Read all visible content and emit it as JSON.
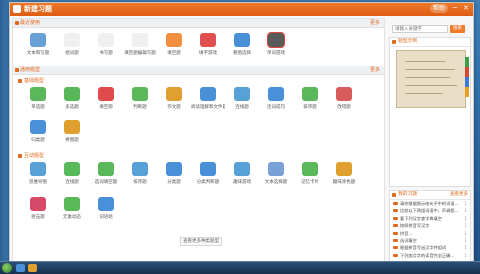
{
  "window": {
    "title": "新建习题",
    "help_label": "帮助",
    "min": "─",
    "close": "✕"
  },
  "recent_section": {
    "title": "最近使用",
    "more": "更多"
  },
  "recent_tiles": [
    {
      "label": "文本和写题",
      "icon": "vol-icon",
      "color": "#6aa0d8"
    },
    {
      "label": "组词题",
      "icon": "word-icon",
      "color": "#f0f0f0"
    },
    {
      "label": "书写题",
      "icon": "write-icon",
      "color": "#f0f0f0"
    },
    {
      "label": "填空题编辑写题",
      "icon": "edit-icon",
      "color": "#f0f0f0"
    },
    {
      "label": "填空题",
      "icon": "blocks-icon",
      "color": "#f09040"
    },
    {
      "label": "填字游戏",
      "icon": "grid-icon",
      "color": "#e05050"
    },
    {
      "label": "看图选择",
      "icon": "abc-icon",
      "color": "#4a90d8"
    },
    {
      "label": "单词游戏",
      "icon": "game-icon",
      "color": "#5a5a5a"
    }
  ],
  "common_section": {
    "title": "通用题型",
    "more": "更多"
  },
  "basic_label": "基础题型",
  "basic_row1": [
    {
      "label": "单选题",
      "icon": "single-choice-icon",
      "color": "#58b85a"
    },
    {
      "label": "多选题",
      "icon": "multi-choice-icon",
      "color": "#58b85a"
    },
    {
      "label": "填空题",
      "icon": "question-icon",
      "color": "#e04a4a"
    },
    {
      "label": "判断题",
      "icon": "judge-icon",
      "color": "#58b85a"
    },
    {
      "label": "作文题",
      "icon": "pen-icon",
      "color": "#e0a030"
    },
    {
      "label": "阅读理解和文件题",
      "icon": "check-grid-icon",
      "color": "#4a90d8"
    },
    {
      "label": "连线题",
      "icon": "link-icon",
      "color": "#58a0d8"
    },
    {
      "label": "连词成句",
      "icon": "font-icon",
      "color": "#4a90d8"
    },
    {
      "label": "排序题",
      "icon": "sort-icon",
      "color": "#58b85a"
    },
    {
      "label": "改错题",
      "icon": "error-icon",
      "color": "#d85a5a"
    }
  ],
  "basic_row2": [
    {
      "label": "归类题",
      "icon": "bar-chart-icon",
      "color": "#4a90d8"
    },
    {
      "label": "拼图题",
      "icon": "puzzle-icon",
      "color": "#e0a030"
    }
  ],
  "interactive_label": "互动题型",
  "interactive_row": [
    {
      "label": "思维导图",
      "icon": "mindmap-icon",
      "color": "#58a0d8"
    },
    {
      "label": "连线题",
      "icon": "connect-icon",
      "color": "#58b85a"
    },
    {
      "label": "选词填空题",
      "icon": "abc-choose-icon",
      "color": "#58b85a"
    },
    {
      "label": "排序题",
      "icon": "order-icon",
      "color": "#58a0d8"
    },
    {
      "label": "分类题",
      "icon": "ab-icon",
      "color": "#4a90d8"
    },
    {
      "label": "分类判断题",
      "icon": "help-icon",
      "color": "#4a90d8"
    },
    {
      "label": "趣味游戏",
      "icon": "cloud-abc-icon",
      "color": "#58a0d8"
    },
    {
      "label": "文本选择题",
      "icon": "text-select-icon",
      "color": "#7aa0d8"
    },
    {
      "label": "记忆卡片",
      "icon": "card-icon",
      "color": "#58b85a"
    },
    {
      "label": "趣味涂色题",
      "icon": "paint-icon",
      "color": "#e0a030"
    }
  ],
  "interactive_row2": [
    {
      "label": "射击题",
      "icon": "target-icon",
      "color": "#d84a6a"
    },
    {
      "label": "元素动态",
      "icon": "shapes-icon",
      "color": "#58b85a"
    },
    {
      "label": "词语组",
      "icon": "network-icon",
      "color": "#4a90d8"
    }
  ],
  "more_button": "查看更多种类题型",
  "search": {
    "placeholder": "请输入关键字",
    "button": "搜索"
  },
  "preview": {
    "title": "题型示例",
    "edit": "编辑",
    "confirm": "确定"
  },
  "recent_panel": {
    "title": "我的习题",
    "more": "查看更多",
    "items": [
      {
        "text": "请你根据图示给句子中的词语…",
        "count": "1"
      },
      {
        "text": "比较以下两组词语中，声调相…",
        "count": "1"
      },
      {
        "text": "看下列汉字查字典填空",
        "count": "1"
      },
      {
        "text": "按照拼音写汉字",
        "count": "1"
      },
      {
        "text": "拼音…",
        "count": "1"
      },
      {
        "text": "选词填空",
        "count": "1"
      },
      {
        "text": "根据拼音写出汉字并组词",
        "count": "1"
      },
      {
        "text": "下列加点字的读音完全正确…",
        "count": "1"
      }
    ]
  }
}
